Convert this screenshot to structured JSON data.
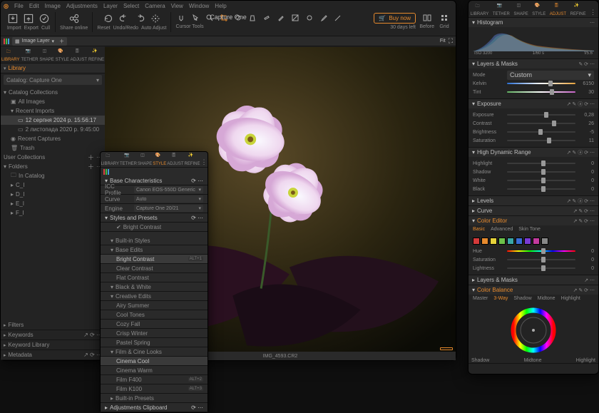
{
  "app": {
    "title": "Capture One",
    "days_left": "30 days left",
    "buy": "Buy now"
  },
  "menu": [
    "File",
    "Edit",
    "Image",
    "Adjustments",
    "Layer",
    "Select",
    "Camera",
    "View",
    "Window",
    "Help"
  ],
  "toolbar": {
    "groups": [
      {
        "items": [
          {
            "n": "import",
            "l": "Import"
          },
          {
            "n": "export",
            "l": "Export"
          },
          {
            "n": "cull",
            "l": "Cull"
          }
        ]
      },
      {
        "items": [
          {
            "n": "share",
            "l": "Share online"
          }
        ]
      },
      {
        "items": [
          {
            "n": "reset",
            "l": "Reset"
          },
          {
            "n": "undoredo",
            "l": "Undo/Redo"
          },
          {
            "n": "autoadjust",
            "l": "Auto Adjust"
          }
        ]
      }
    ],
    "cursor_label": "Cursor Tools",
    "right": [
      {
        "n": "before"
      },
      {
        "n": "grid"
      }
    ]
  },
  "secbar": {
    "layer": "Image Layer",
    "zoom": "Fit"
  },
  "tooltabs": [
    {
      "n": "library",
      "l": "LIBRARY"
    },
    {
      "n": "tether",
      "l": "TETHER"
    },
    {
      "n": "shape",
      "l": "SHAPE"
    },
    {
      "n": "style",
      "l": "STYLE"
    },
    {
      "n": "adjust",
      "l": "ADJUST"
    },
    {
      "n": "refine",
      "l": "REFINE"
    }
  ],
  "library": {
    "title": "Library",
    "catalog": "Catalog: Capture One",
    "collections_head": "Catalog Collections",
    "collections": [
      "All Images"
    ],
    "recent_head": "Recent Imports",
    "recent": [
      {
        "t": "12 серпня 2024 р. 15:56:17",
        "sel": true
      },
      {
        "t": "2 листопада 2020 р. 9:45:00"
      }
    ],
    "captures": "Recent Captures",
    "trash": "Trash",
    "user_head": "User Collections",
    "folders_head": "Folders",
    "folders": [
      "In Catalog",
      "C_I",
      "D_I",
      "E_I",
      "F_I"
    ],
    "lower": [
      "Filters",
      "Keywords",
      "Keyword Library",
      "Metadata"
    ]
  },
  "viewer": {
    "filename": "IMG_4593.CR2"
  },
  "stylepanel": {
    "tabs_active": "STYLE",
    "base_head": "Base Characteristics",
    "base": [
      {
        "l": "ICC Profile",
        "v": "Canon EOS-550D Generic"
      },
      {
        "l": "Curve",
        "v": "Auto"
      },
      {
        "l": "Engine",
        "v": "Capture One 20/21"
      }
    ],
    "styles_head": "Styles and Presets",
    "applied": "Bright Contrast",
    "builtin_head": "Built-in Styles",
    "cats": [
      {
        "h": "Base Edits",
        "items": [
          {
            "t": "Bright Contrast",
            "k": "ALT+1",
            "sel": true
          },
          {
            "t": "Clear Contrast"
          },
          {
            "t": "Flat Contrast"
          }
        ]
      },
      {
        "h": "Black & White",
        "items": []
      },
      {
        "h": "Creative Edits",
        "items": [
          {
            "t": "Airy Summer"
          },
          {
            "t": "Cool Tones"
          },
          {
            "t": "Cozy Fall"
          },
          {
            "t": "Crisp Winter"
          },
          {
            "t": "Pastel Spring"
          }
        ]
      },
      {
        "h": "Film & Cine Looks",
        "items": [
          {
            "t": "Cinema Cool",
            "sel": true
          },
          {
            "t": "Cinema Warm"
          },
          {
            "t": "Film F400",
            "k": "ALT+2"
          },
          {
            "t": "Film K100",
            "k": "ALT+3"
          }
        ]
      }
    ],
    "preset_head": "Built-in Presets",
    "clip_head": "Adjustments Clipboard"
  },
  "right": {
    "tabs_active": "ADJUST",
    "hist": {
      "title": "Histogram",
      "iso": "ISO 3200",
      "shutter": "1/60 s",
      "ap": "f/5.6"
    },
    "layers": {
      "title": "Layers & Masks",
      "mode_l": "Mode",
      "mode_v": "Custom",
      "rows": [
        {
          "l": "Kelvin",
          "v": "6150",
          "p": 60,
          "g": "grad-kelvin"
        },
        {
          "l": "Tint",
          "v": "30",
          "p": 62,
          "g": "grad-tint"
        }
      ]
    },
    "exposure": {
      "title": "Exposure",
      "rows": [
        {
          "l": "Exposure",
          "v": "0,28",
          "p": 54
        },
        {
          "l": "Contrast",
          "v": "26",
          "p": 66
        },
        {
          "l": "Brightness",
          "v": "-5",
          "p": 46
        },
        {
          "l": "Saturation",
          "v": "11",
          "p": 58
        }
      ]
    },
    "hdr": {
      "title": "High Dynamic Range",
      "rows": [
        {
          "l": "Highlight",
          "v": "0",
          "p": 50
        },
        {
          "l": "Shadow",
          "v": "0",
          "p": 50
        },
        {
          "l": "White",
          "v": "0",
          "p": 50
        },
        {
          "l": "Black",
          "v": "0",
          "p": 50
        }
      ]
    },
    "levels": {
      "title": "Levels"
    },
    "curve": {
      "title": "Curve"
    },
    "coloreditor": {
      "title": "Color Editor",
      "tabs": [
        "Basic",
        "Advanced",
        "Skin Tone"
      ],
      "swatches": [
        "#d43a3a",
        "#e68a2e",
        "#e6d23a",
        "#6cc24a",
        "#3aa6a6",
        "#3a6cd4",
        "#7a3ad4",
        "#c43a9e",
        "#888"
      ],
      "rows": [
        {
          "l": "Hue",
          "v": "0",
          "p": 50,
          "g": "grad-hue"
        },
        {
          "l": "Saturation",
          "v": "0",
          "p": 50
        },
        {
          "l": "Lightness",
          "v": "0",
          "p": 50
        }
      ]
    },
    "colorbalance": {
      "title": "Color Balance",
      "tabs": [
        "Master",
        "3-Way",
        "Shadow",
        "Midtone",
        "Highlight"
      ],
      "labels": [
        "Shadow",
        "Midtone",
        "Highlight"
      ]
    }
  }
}
